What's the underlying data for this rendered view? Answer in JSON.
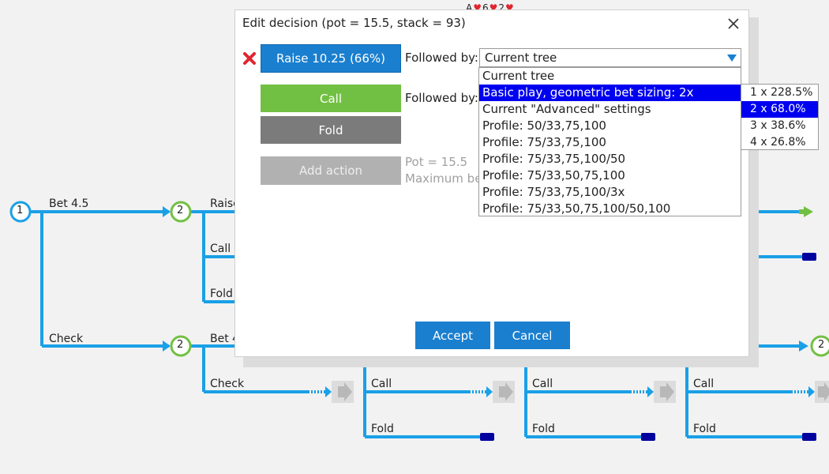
{
  "dialog": {
    "title": "Edit decision (pot = 15.5, stack = 93)",
    "close_icon": "close-x-icon",
    "actions": [
      {
        "label": "Raise 10.25 (66%)",
        "color": "#1a7fcf",
        "followed_by_label": "Followed by:"
      },
      {
        "label": "Call",
        "color": "#72c043",
        "followed_by_label": "Followed by:"
      },
      {
        "label": "Fold",
        "color": "#7b7b7b"
      }
    ],
    "add_action_label": "Add action",
    "pot_text": "Pot = 15.5",
    "max_bet_text": "Maximum bet",
    "select_value": "Current tree",
    "accept_label": "Accept",
    "cancel_label": "Cancel"
  },
  "dropdown": {
    "options": [
      "Current tree",
      "Basic play, geometric bet sizing: 2x",
      "Current \"Advanced\" settings",
      "Profile: 50/33,75,100",
      "Profile: 75/33,75,100",
      "Profile: 75/33,75,100/50",
      "Profile: 75/33,50,75,100",
      "Profile: 75/33,75,100/3x",
      "Profile: 75/33,50,75,100/50,100"
    ],
    "selected_index": 1,
    "submenu": [
      "1 x 228.5%",
      "2 x 68.0%",
      "3 x 38.6%",
      "4 x 26.8%"
    ],
    "submenu_selected_index": 1
  },
  "top_cards": {
    "a": "A",
    "b": "6",
    "c": "2"
  },
  "tree": {
    "node_root": "1",
    "node_a": "2",
    "node_b": "2",
    "node_right": "2",
    "labels": {
      "bet": "Bet 4.5",
      "raise": "Raise",
      "call_a": "Call",
      "fold_a": "Fold",
      "check": "Check",
      "bet_b": "Bet 4",
      "check_b": "Check",
      "call_1": "Call",
      "fold_1": "Fold",
      "call_2": "Call",
      "fold_2": "Fold",
      "call_3": "Call",
      "fold_3": "Fold"
    },
    "colors": {
      "line": "#1aa0e6",
      "node_blue": "#1aa0e6",
      "node_green": "#72c043",
      "terminal": "#00009e"
    }
  }
}
